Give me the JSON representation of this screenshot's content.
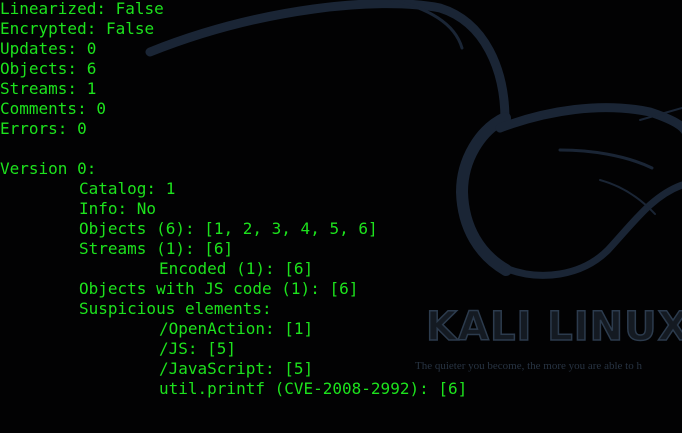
{
  "summary": [
    "Linearized: False",
    "Encrypted: False",
    "Updates: 0",
    "Objects: 6",
    "Streams: 1",
    "Comments: 0",
    "Errors: 0"
  ],
  "version": {
    "heading": "Version 0:",
    "catalog": "Catalog: 1",
    "info": "Info: No",
    "objects": "Objects (6): [1, 2, 3, 4, 5, 6]",
    "streams": "Streams (1): [6]",
    "encoded": "Encoded (1): [6]",
    "js_objects": "Objects with JS code (1): [6]",
    "suspicious": {
      "heading": "Suspicious elements:",
      "items": [
        "/OpenAction: [1]",
        "/JS: [5]",
        "/JavaScript: [5]",
        "util.printf (CVE-2008-2992): [6]"
      ]
    }
  },
  "wallpaper": {
    "brand": "KALI LINUX",
    "tagline": "The quieter you become, the more you are able to h"
  },
  "colors": {
    "terminal_text": "#1de21d",
    "background": "#020203",
    "dragon": "#1a2535"
  }
}
